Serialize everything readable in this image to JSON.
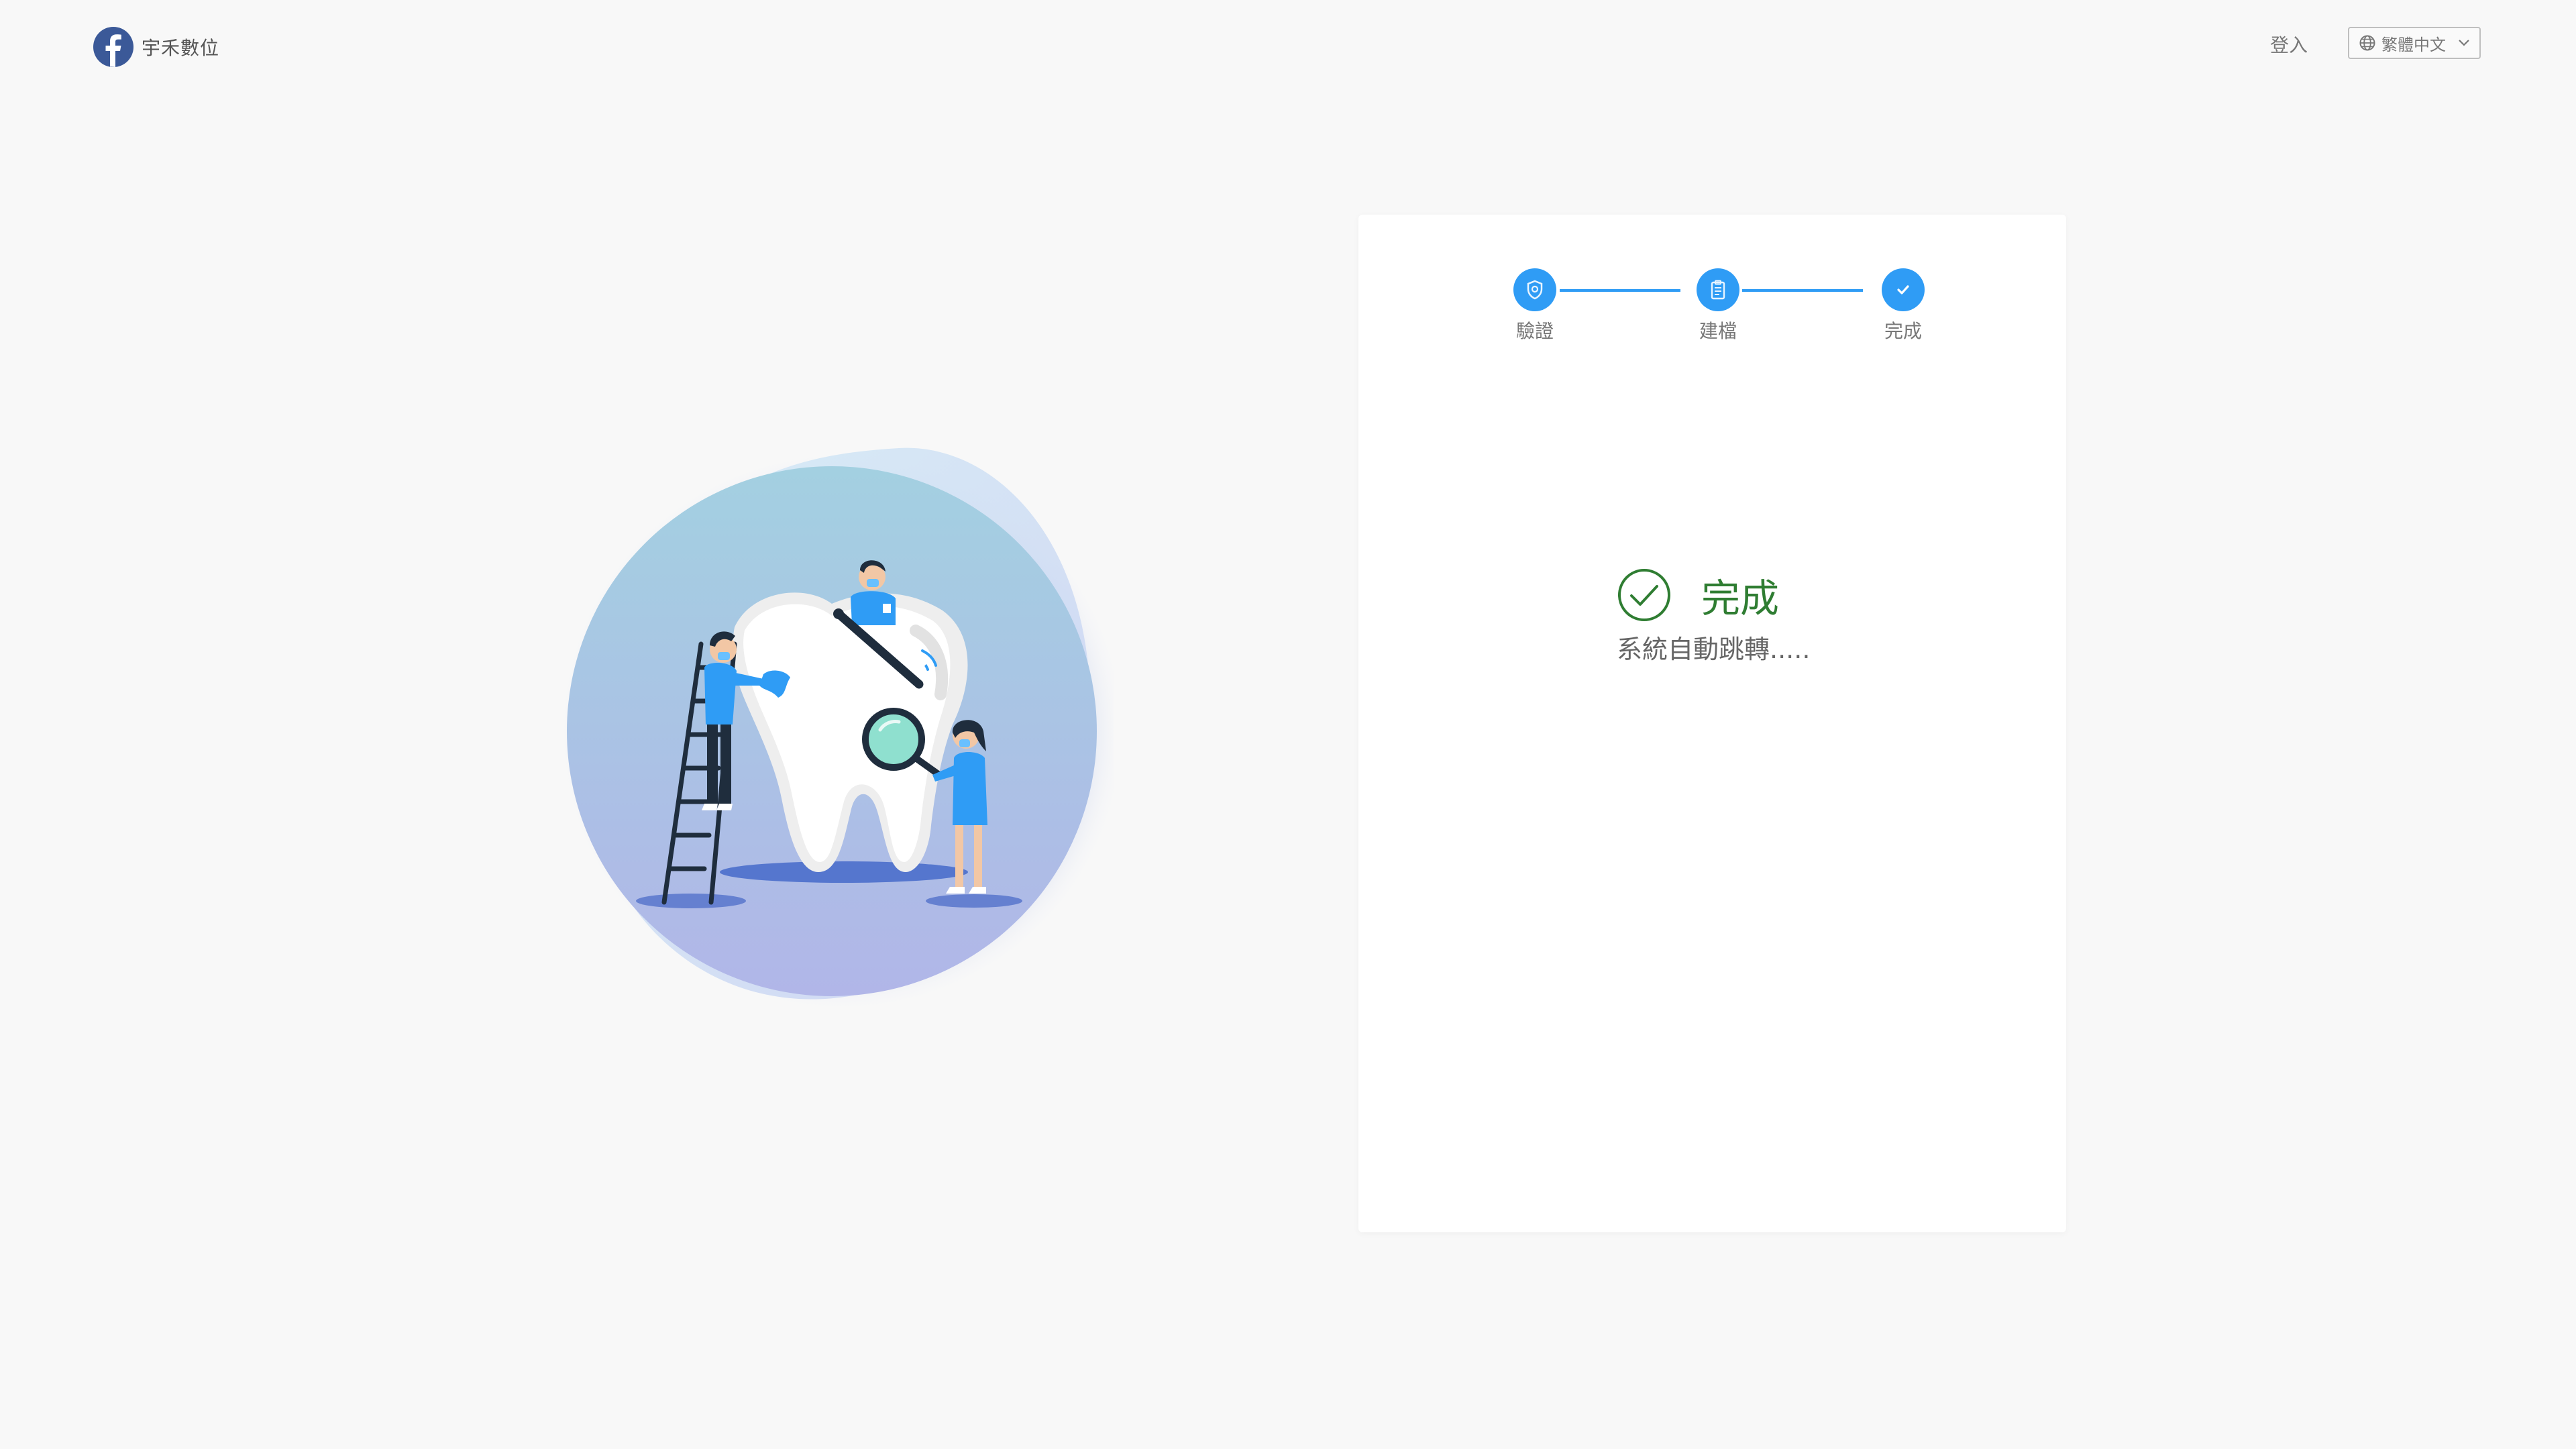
{
  "header": {
    "brand_name": "宇禾數位",
    "login_label": "登入",
    "language": {
      "selected": "繁體中文"
    }
  },
  "illustration": {
    "icon": "tooth-dental-care-illustration"
  },
  "steps": [
    {
      "label": "驗證",
      "icon": "shield-icon",
      "state": "done"
    },
    {
      "label": "建檔",
      "icon": "clipboard-icon",
      "state": "done"
    },
    {
      "label": "完成",
      "icon": "check-icon",
      "state": "active"
    }
  ],
  "result": {
    "title": "完成",
    "message": "系統自動跳轉....."
  },
  "colors": {
    "accent": "#2f9cf5",
    "success": "#2f7d32",
    "background": "#f8f8f8"
  }
}
